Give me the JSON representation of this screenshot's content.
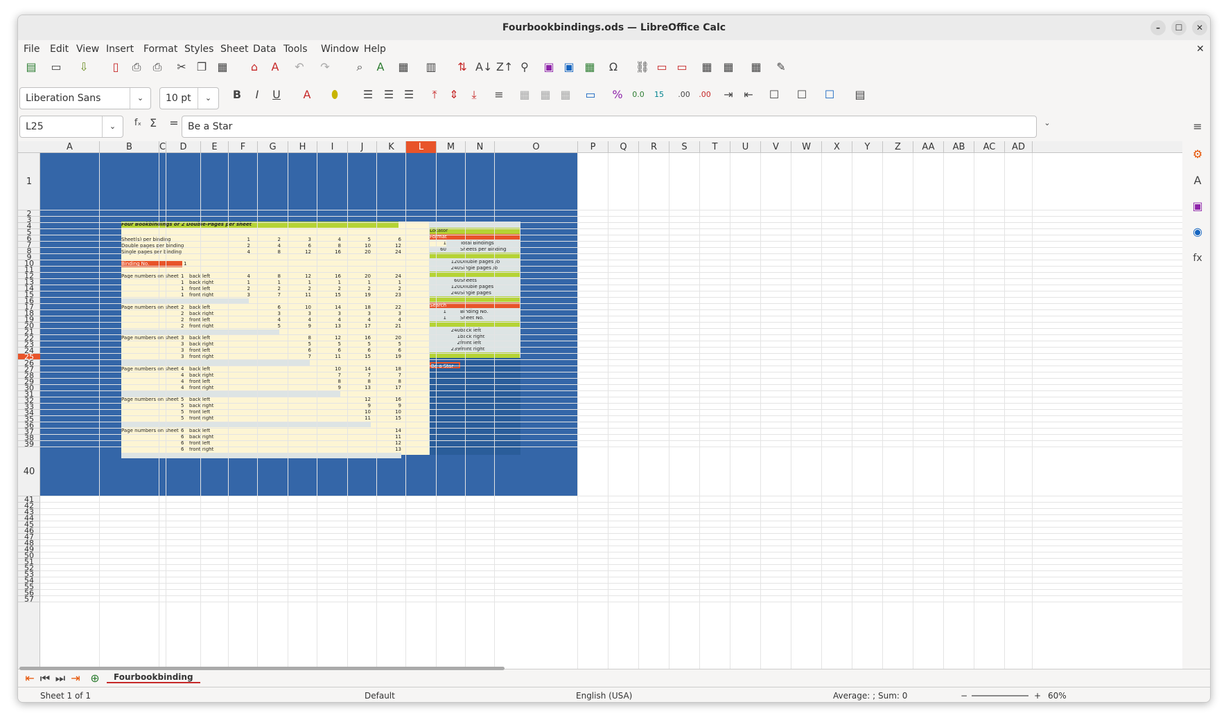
{
  "window": {
    "title": "Fourbookbindings.ods — LibreOffice Calc"
  },
  "menu": [
    "File",
    "Edit",
    "View",
    "Insert",
    "Format",
    "Styles",
    "Sheet",
    "Data",
    "Tools",
    "Window",
    "Help"
  ],
  "toolbar": {
    "font_name": "Liberation Sans",
    "font_size": "10 pt"
  },
  "formula": {
    "cell_ref": "L25",
    "content": "Be a Star",
    "fx": "fₓ",
    "sigma": "Σ",
    "equals": "="
  },
  "columns": [
    "A",
    "B",
    "C",
    "D",
    "E",
    "F",
    "G",
    "H",
    "I",
    "J",
    "K",
    "L",
    "M",
    "N",
    "O",
    "P",
    "Q",
    "R",
    "S",
    "T",
    "U",
    "V",
    "W",
    "X",
    "Y",
    "Z",
    "AA",
    "AB",
    "AC",
    "AD"
  ],
  "rows": [
    "1",
    "2",
    "3",
    "4",
    "5",
    "6",
    "7",
    "8",
    "9",
    "10",
    "11",
    "12",
    "13",
    "14",
    "15",
    "16",
    "17",
    "18",
    "19",
    "20",
    "21",
    "22",
    "23",
    "24",
    "25",
    "26",
    "27",
    "28",
    "29",
    "30",
    "31",
    "32",
    "33",
    "34",
    "35",
    "36",
    "37",
    "38",
    "39",
    "40",
    "41",
    "42",
    "43",
    "44",
    "45",
    "46",
    "47",
    "48",
    "49",
    "50",
    "51",
    "52",
    "53",
    "54",
    "55",
    "56",
    "57"
  ],
  "overview": {
    "title": "Four Bookbindings or 2 Double-Pages per sheet",
    "r4": {
      "label": "Sheet(s) per binding",
      "v": [
        "1",
        "2",
        "3",
        "4",
        "5",
        "6"
      ]
    },
    "r5": {
      "label": "Double pages per binding",
      "v": [
        "2",
        "4",
        "6",
        "8",
        "10",
        "12"
      ]
    },
    "r6": {
      "label": "Single pages per binding",
      "v": [
        "4",
        "8",
        "12",
        "16",
        "20",
        "24"
      ]
    },
    "binding_label": "Binding No.",
    "binding_value": "1",
    "group_label": "Page numbers on sheet no.",
    "groups": [
      {
        "no": "1",
        "rows": [
          [
            "back left",
            "4",
            "8",
            "12",
            "16",
            "20",
            "24"
          ],
          [
            "back right",
            "1",
            "1",
            "1",
            "1",
            "1",
            "1"
          ],
          [
            "front left",
            "2",
            "2",
            "2",
            "2",
            "2",
            "2"
          ],
          [
            "front right",
            "3",
            "7",
            "11",
            "15",
            "19",
            "23"
          ]
        ]
      },
      {
        "no": "2",
        "rows": [
          [
            "back left",
            "6",
            "10",
            "14",
            "18",
            "22"
          ],
          [
            "back right",
            "3",
            "3",
            "3",
            "3",
            "3"
          ],
          [
            "front left",
            "4",
            "4",
            "4",
            "4",
            "4"
          ],
          [
            "front right",
            "5",
            "9",
            "13",
            "17",
            "21"
          ]
        ]
      },
      {
        "no": "3",
        "rows": [
          [
            "back left",
            "8",
            "12",
            "16",
            "20"
          ],
          [
            "back right",
            "5",
            "5",
            "5",
            "5"
          ],
          [
            "front left",
            "6",
            "6",
            "6",
            "6"
          ],
          [
            "front right",
            "7",
            "11",
            "15",
            "19"
          ]
        ]
      },
      {
        "no": "4",
        "rows": [
          [
            "back left",
            "10",
            "14",
            "18"
          ],
          [
            "back right",
            "7",
            "7",
            "7"
          ],
          [
            "front left",
            "8",
            "8",
            "8"
          ],
          [
            "front right",
            "9",
            "13",
            "17"
          ]
        ]
      },
      {
        "no": "5",
        "rows": [
          [
            "back left",
            "12",
            "16"
          ],
          [
            "back right",
            "9",
            "9"
          ],
          [
            "front left",
            "10",
            "10"
          ],
          [
            "front right",
            "11",
            "15"
          ]
        ]
      },
      {
        "no": "6",
        "rows": [
          [
            "back left",
            "14"
          ],
          [
            "back right",
            "11"
          ],
          [
            "front left",
            "12"
          ],
          [
            "front right",
            "13"
          ]
        ]
      }
    ]
  },
  "locator": {
    "title": "Locator",
    "format": "Format",
    "total_n": "1",
    "total_l": "Total Bindings",
    "spb_n": "60",
    "spb_l": "Sheets per Binding",
    "dp_n": "120",
    "dp_l": "Double pages /b",
    "sp_n": "240",
    "sp_l": "Single pages /b",
    "sh_n": "60",
    "sh_l": "Sheets",
    "dp2_n": "120",
    "dp2_l": "Double pages",
    "sp2_n": "240",
    "sp2_l": "Single pages",
    "search": "Search",
    "bn_n": "1",
    "bn_l": "Binding No.",
    "sn_n": "1",
    "sn_l": "Sheet No.",
    "r1": "240",
    "r1l": "back left",
    "r2": "1",
    "r2l": "back right",
    "r3": "2",
    "r3l": "front left",
    "r4": "239",
    "r4l": "front right",
    "star": "Be a Star"
  },
  "sheet_tab": "Fourbookbinding",
  "status": {
    "sheet": "Sheet 1 of 1",
    "style": "Default",
    "lang": "English (USA)",
    "sum": "Average: ; Sum: 0",
    "zoom": "60%"
  }
}
